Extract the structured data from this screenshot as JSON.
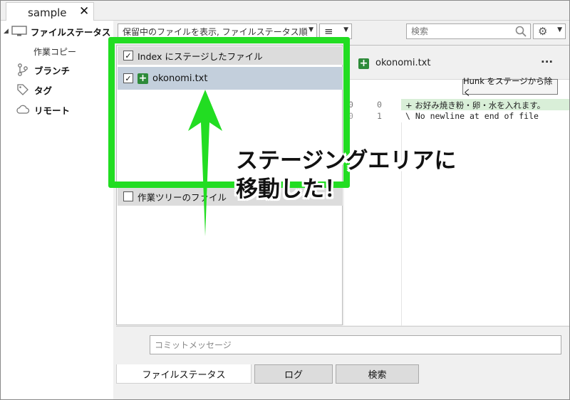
{
  "window": {
    "tab_label": "sample",
    "tab_close": "✕"
  },
  "sidebar": {
    "file_status": "ファイルステータス",
    "working_copy": "作業コピー",
    "branches": "ブランチ",
    "tags": "タグ",
    "remotes": "リモート"
  },
  "toolbar": {
    "filter_combo": "保留中のファイルを表示, ファイルステータス順",
    "search_placeholder": "検索"
  },
  "staged": {
    "header_label": "Index にステージしたファイル",
    "header_checked": "✓",
    "files": [
      {
        "name": "okonomi.txt",
        "checked": "✓",
        "status": "+"
      }
    ]
  },
  "unstaged": {
    "header_label": "作業ツリーのファイル",
    "header_checked": ""
  },
  "diff": {
    "filename": "okonomi.txt",
    "file_status": "+",
    "more": "···",
    "hunk_button": "Hunk をステージから除く",
    "lines": [
      {
        "old": "0",
        "new": "0",
        "text": "+ お好み焼き粉・卵・水を入れます。",
        "kind": "added"
      },
      {
        "old": "0",
        "new": "1",
        "text": "\\  No newline at end of file",
        "kind": "meta"
      }
    ]
  },
  "commit": {
    "placeholder": "コミットメッセージ"
  },
  "bottom_tabs": [
    {
      "label": "ファイルステータス",
      "active": true
    },
    {
      "label": "ログ",
      "active": false
    },
    {
      "label": "検索",
      "active": false
    }
  ],
  "annotation": {
    "line1": "ステージングエリアに",
    "line2": "移動した！",
    "color": "#22dd22"
  }
}
